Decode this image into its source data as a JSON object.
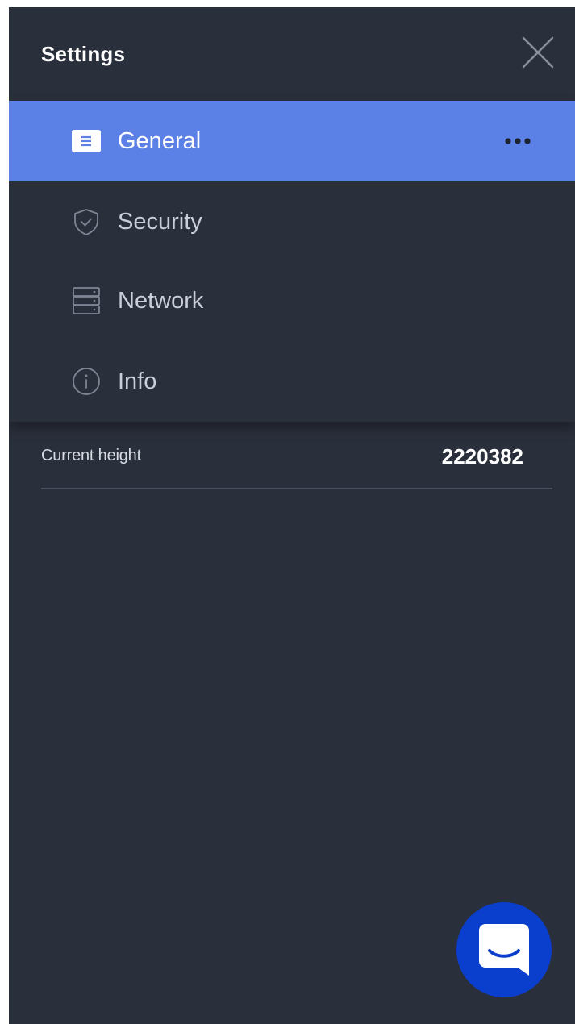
{
  "header": {
    "title": "Settings"
  },
  "menu": {
    "items": [
      {
        "label": "General",
        "icon": "document-icon",
        "active": true
      },
      {
        "label": "Security",
        "icon": "shield-check-icon",
        "active": false
      },
      {
        "label": "Network",
        "icon": "server-icon",
        "active": false
      },
      {
        "label": "Info",
        "icon": "info-icon",
        "active": false
      }
    ]
  },
  "status": {
    "label": "Current height",
    "value": "2220382"
  },
  "colors": {
    "background": "#2a2f3c",
    "active_item": "#5b80e6",
    "chat_button": "#0a3fcd",
    "divider": "#4a5060"
  }
}
